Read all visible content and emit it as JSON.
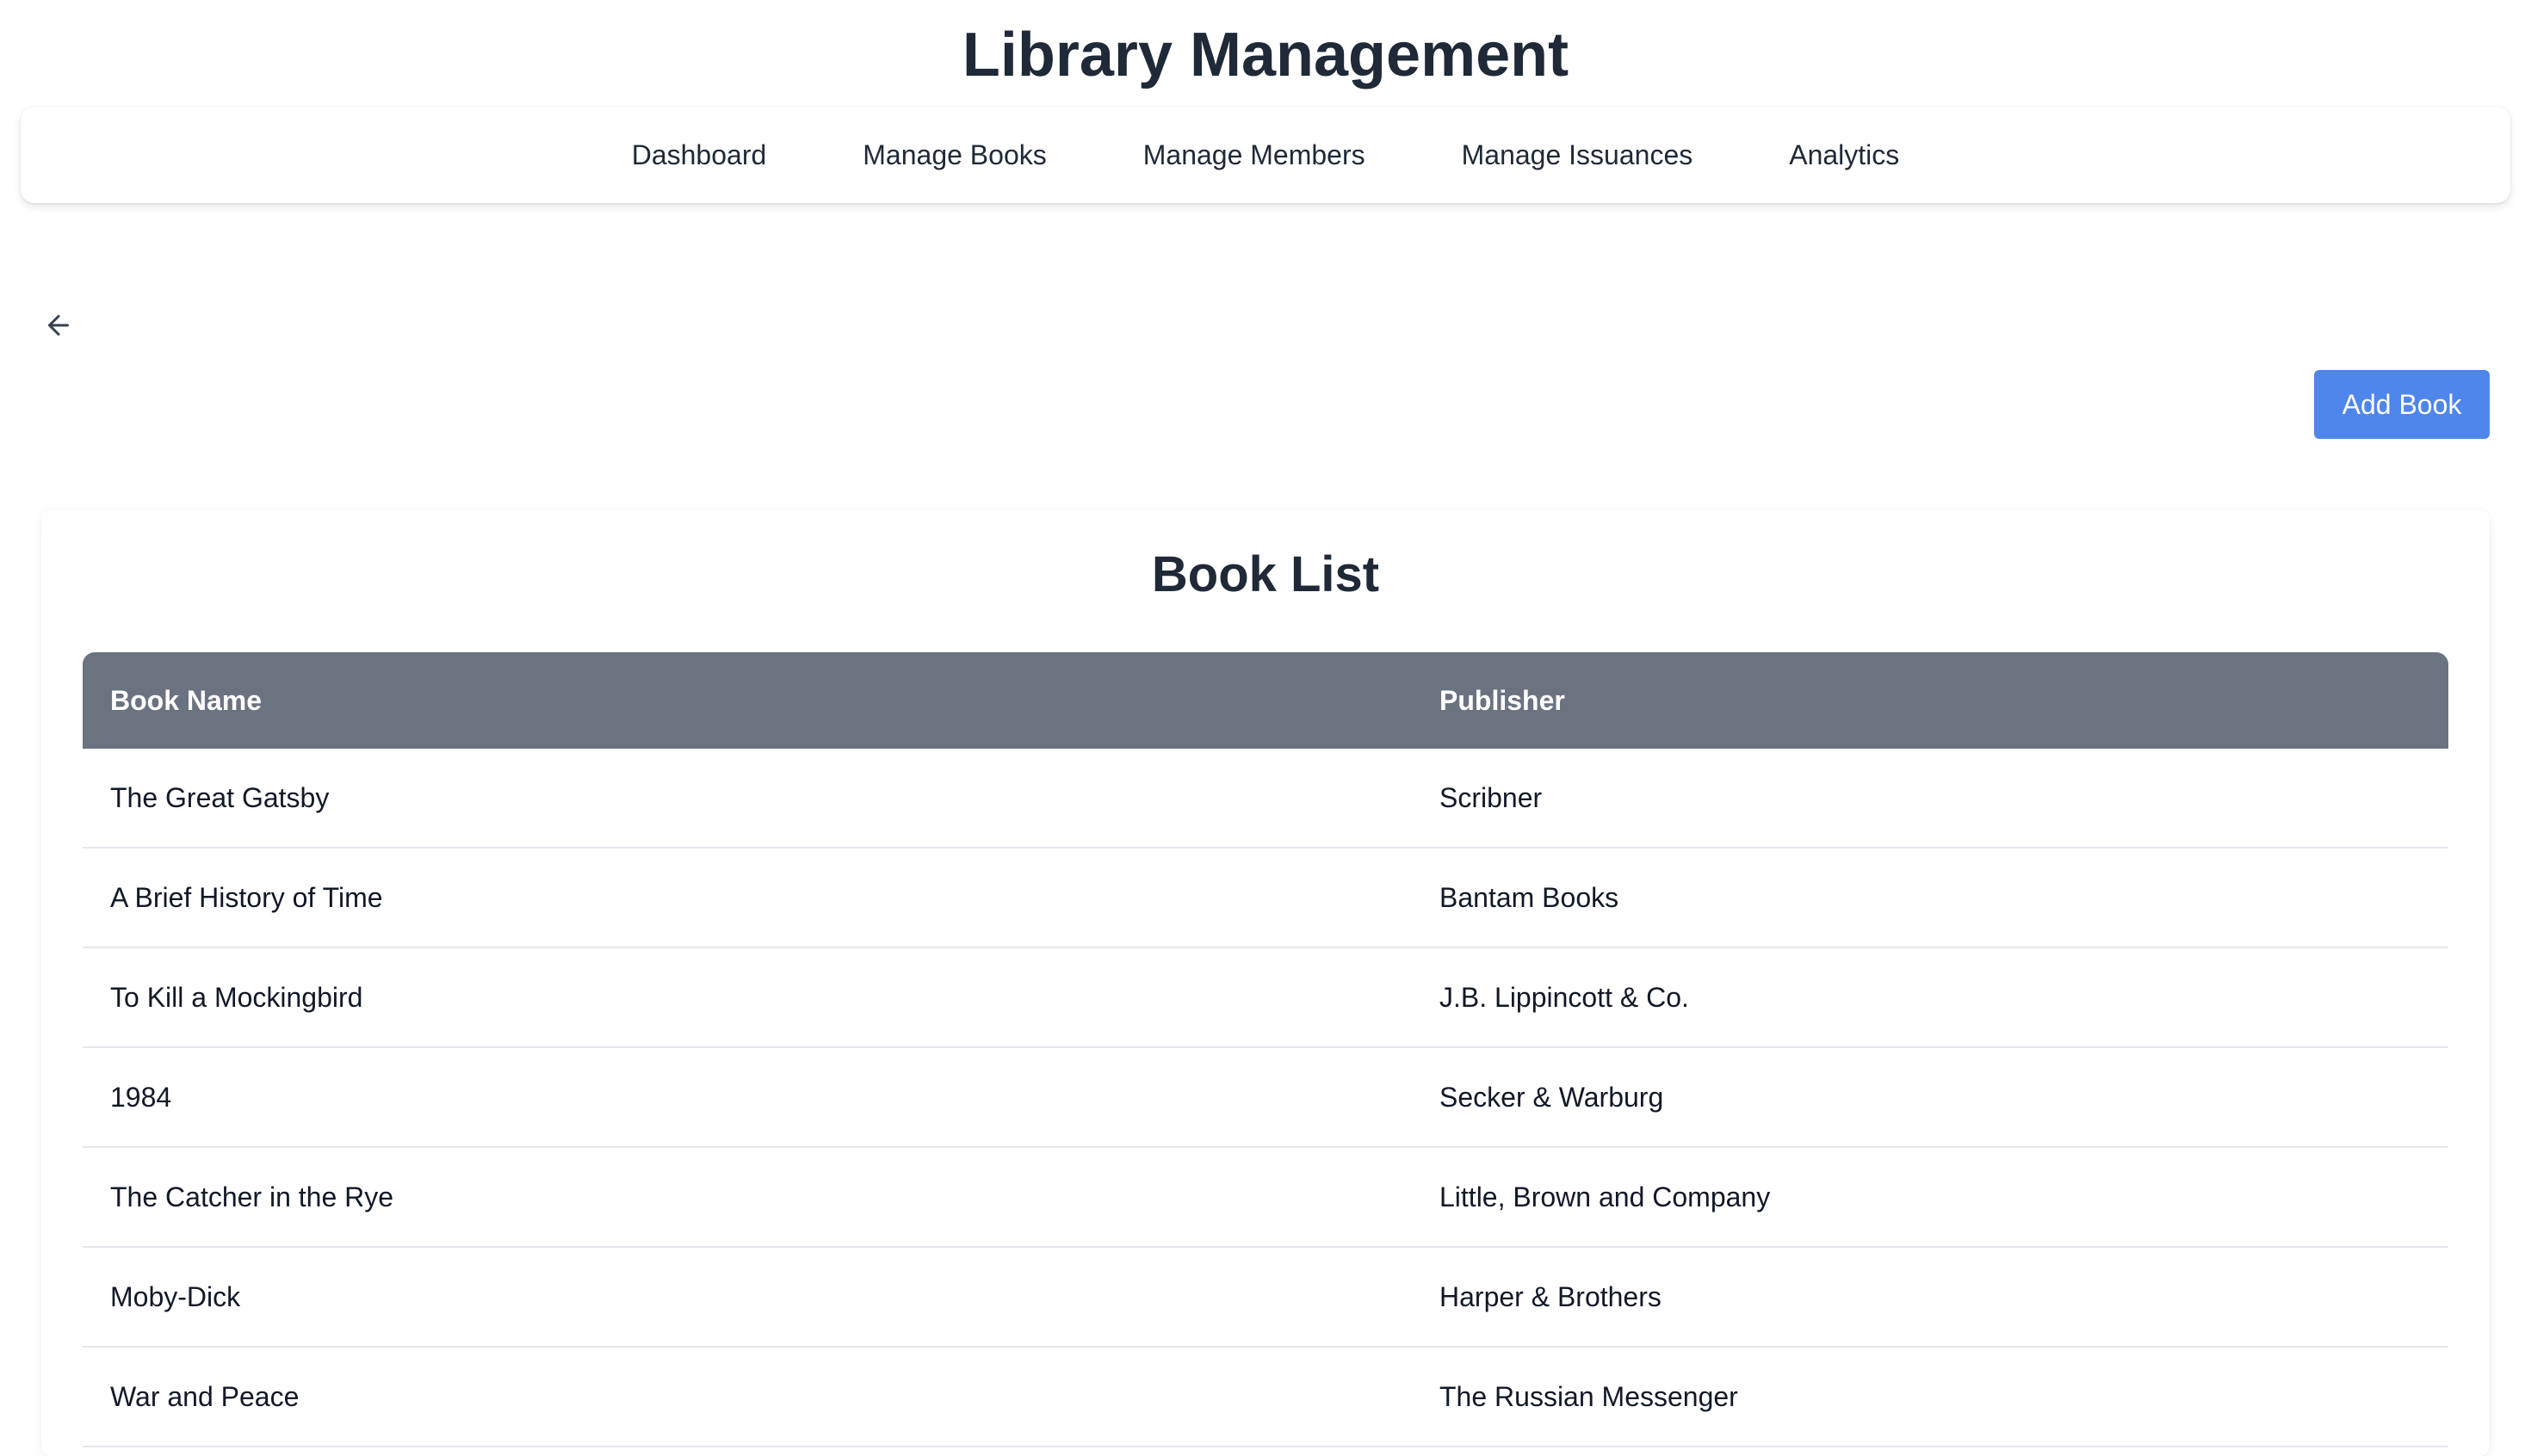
{
  "app": {
    "title": "Library Management"
  },
  "nav": {
    "items": [
      {
        "label": "Dashboard"
      },
      {
        "label": "Manage Books"
      },
      {
        "label": "Manage Members"
      },
      {
        "label": "Manage Issuances"
      },
      {
        "label": "Analytics"
      }
    ]
  },
  "toolbar": {
    "back_icon": "arrow-left-icon",
    "add_label": "Add Book"
  },
  "book_list": {
    "title": "Book List",
    "columns": [
      "Book Name",
      "Publisher"
    ],
    "rows": [
      {
        "name": "The Great Gatsby",
        "publisher": "Scribner"
      },
      {
        "name": "A Brief History of Time",
        "publisher": "Bantam Books"
      },
      {
        "name": "To Kill a Mockingbird",
        "publisher": "J.B. Lippincott & Co."
      },
      {
        "name": "1984",
        "publisher": "Secker & Warburg"
      },
      {
        "name": "The Catcher in the Rye",
        "publisher": "Little, Brown and Company"
      },
      {
        "name": "Moby-Dick",
        "publisher": "Harper & Brothers"
      },
      {
        "name": "War and Peace",
        "publisher": "The Russian Messenger"
      }
    ]
  },
  "colors": {
    "accent": "#4f86ec",
    "table_header": "#6b7280",
    "heading_text": "#1f2937"
  }
}
